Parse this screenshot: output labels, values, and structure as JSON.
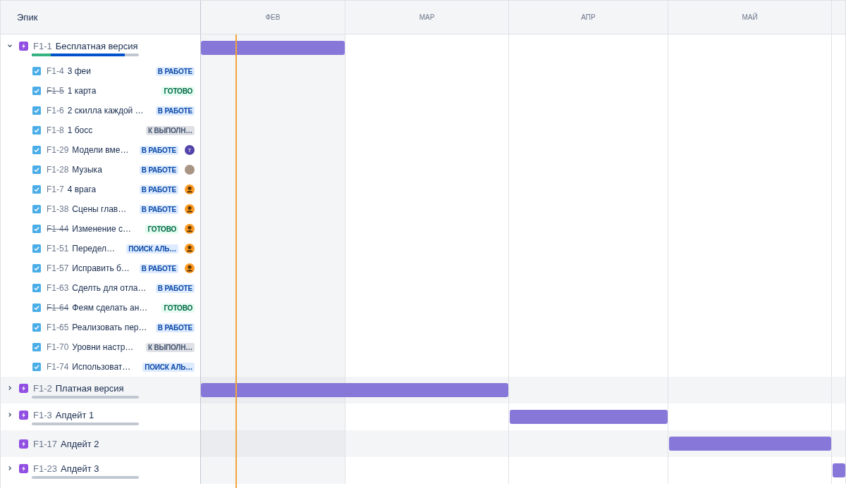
{
  "header": {
    "column_title": "Эпик",
    "months": [
      "ФЕВ",
      "МАР",
      "АПР",
      "МАЙ"
    ]
  },
  "epics": [
    {
      "key": "F1-1",
      "title": "Бесплатная версия",
      "expandable": true,
      "expanded": true,
      "progress_bar": true,
      "segments": [
        {
          "kind": "in_progress",
          "level": 0.87
        },
        {
          "kind": "done",
          "level": 0.18
        }
      ],
      "bar_months": [
        true,
        false,
        false,
        false,
        false
      ],
      "issues": [
        {
          "key": "F1-4",
          "title": "3 феи",
          "done": false,
          "status": {
            "text": "В РАБОТЕ",
            "kind": "in_progress"
          }
        },
        {
          "key": "F1-5",
          "title": "1 карта",
          "done": true,
          "status": {
            "text": "ГОТОВО",
            "kind": "done"
          }
        },
        {
          "key": "F1-6",
          "title": "2 скилла каждой …",
          "done": false,
          "status": {
            "text": "В РАБОТЕ",
            "kind": "in_progress"
          }
        },
        {
          "key": "F1-8",
          "title": "1 босс",
          "done": false,
          "status": {
            "text": "К ВЫПОЛН…",
            "kind": "todo"
          }
        },
        {
          "key": "F1-29",
          "title": "Модели вме…",
          "done": false,
          "status": {
            "text": "В РАБОТЕ",
            "kind": "in_progress"
          },
          "avatar": {
            "kind": "letter",
            "text": "Т"
          }
        },
        {
          "key": "F1-28",
          "title": "Музыка",
          "done": false,
          "status": {
            "text": "В РАБОТЕ",
            "kind": "in_progress"
          },
          "avatar": {
            "kind": "photo"
          }
        },
        {
          "key": "F1-7",
          "title": "4 врага",
          "done": false,
          "status": {
            "text": "В РАБОТЕ",
            "kind": "in_progress"
          },
          "avatar": {
            "kind": "person"
          }
        },
        {
          "key": "F1-38",
          "title": "Сцены глав…",
          "done": false,
          "status": {
            "text": "В РАБОТЕ",
            "kind": "in_progress"
          },
          "avatar": {
            "kind": "person"
          }
        },
        {
          "key": "F1-44",
          "title": "Изменение с…",
          "done": true,
          "status": {
            "text": "ГОТОВО",
            "kind": "done"
          },
          "avatar": {
            "kind": "person"
          }
        },
        {
          "key": "F1-51",
          "title": "Передел…",
          "done": false,
          "status": {
            "text": "ПОИСК АЛЬ…",
            "kind": "in_progress"
          },
          "avatar": {
            "kind": "person"
          }
        },
        {
          "key": "F1-57",
          "title": "Исправить б…",
          "done": false,
          "status": {
            "text": "В РАБОТЕ",
            "kind": "in_progress"
          },
          "avatar": {
            "kind": "person"
          }
        },
        {
          "key": "F1-63",
          "title": "Сделть для отла…",
          "done": false,
          "status": {
            "text": "В РАБОТЕ",
            "kind": "in_progress"
          }
        },
        {
          "key": "F1-64",
          "title": "Феям сделать ан…",
          "done": true,
          "status": {
            "text": "ГОТОВО",
            "kind": "done"
          }
        },
        {
          "key": "F1-65",
          "title": "Реализовать пер…",
          "done": false,
          "status": {
            "text": "В РАБОТЕ",
            "kind": "in_progress"
          }
        },
        {
          "key": "F1-70",
          "title": "Уровни настр…",
          "done": false,
          "status": {
            "text": "К ВЫПОЛН…",
            "kind": "todo"
          }
        },
        {
          "key": "F1-74",
          "title": "Использоват…",
          "done": false,
          "status": {
            "text": "ПОИСК АЛЬ…",
            "kind": "in_progress"
          }
        }
      ]
    },
    {
      "key": "F1-2",
      "title": "Платная версия",
      "expandable": true,
      "expanded": false,
      "progress_bar": true,
      "bar_months": [
        true,
        true,
        false,
        false,
        false
      ]
    },
    {
      "key": "F1-3",
      "title": "Апдейт 1",
      "expandable": true,
      "expanded": false,
      "progress_bar": true,
      "bar_months": [
        false,
        false,
        true,
        false,
        false
      ]
    },
    {
      "key": "F1-17",
      "title": "Апдейт 2",
      "expandable": false,
      "expanded": false,
      "progress_bar": false,
      "bar_months": [
        false,
        false,
        false,
        true,
        false
      ]
    },
    {
      "key": "F1-23",
      "title": "Апдейт 3",
      "expandable": true,
      "expanded": false,
      "progress_bar": true,
      "bar_months": [
        false,
        false,
        false,
        false,
        true
      ]
    }
  ]
}
